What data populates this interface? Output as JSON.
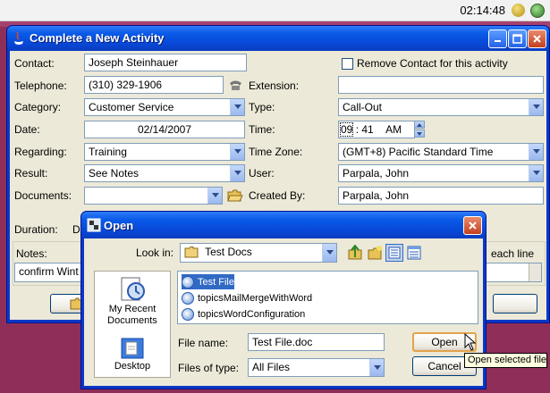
{
  "system": {
    "clock": "02:14:48"
  },
  "main_window": {
    "title": "Complete a New Activity",
    "contact": {
      "label": "Contact:",
      "value": "Joseph Steinhauer"
    },
    "remove_contact": {
      "label": "Remove Contact for this activity",
      "checked": false
    },
    "telephone": {
      "label": "Telephone:",
      "value": "(310) 329-1906"
    },
    "extension": {
      "label": "Extension:",
      "value": ""
    },
    "category": {
      "label": "Category:",
      "value": "Customer Service"
    },
    "type": {
      "label": "Type:",
      "value": "Call-Out"
    },
    "date": {
      "label": "Date:",
      "value": "02/14/2007"
    },
    "time": {
      "label": "Time:",
      "hour": "09",
      "minute": "41",
      "ampm": "AM"
    },
    "regarding": {
      "label": "Regarding:",
      "value": "Training"
    },
    "time_zone": {
      "label": "Time Zone:",
      "value": "(GMT+8) Pacific Standard Time"
    },
    "result": {
      "label": "Result:",
      "value": "See Notes"
    },
    "user": {
      "label": "User:",
      "value": "Parpala, John"
    },
    "documents": {
      "label": "Documents:",
      "value": ""
    },
    "created_by": {
      "label": "Created By:",
      "value": "Parpala, John"
    },
    "duration": {
      "label": "Duration:",
      "partial": "D"
    },
    "notes": {
      "label": "Notes:",
      "value": "confirm Wint",
      "right_partial": "each line"
    }
  },
  "open_dialog": {
    "title": "Open",
    "look_in": {
      "label": "Look in:",
      "value": "Test Docs"
    },
    "places": [
      {
        "label": "My Recent Documents"
      },
      {
        "label": "Desktop"
      }
    ],
    "files": [
      {
        "name": "Test File",
        "selected": true
      },
      {
        "name": "topicsMailMergeWithWord",
        "selected": false
      },
      {
        "name": "topicsWordConfiguration",
        "selected": false
      }
    ],
    "file_name": {
      "label": "File name:",
      "value": "Test File.doc"
    },
    "files_of_type": {
      "label": "Files of type:",
      "value": "All Files"
    },
    "open_button": "Open",
    "cancel_button": "Cancel",
    "tooltip": "Open selected file"
  }
}
